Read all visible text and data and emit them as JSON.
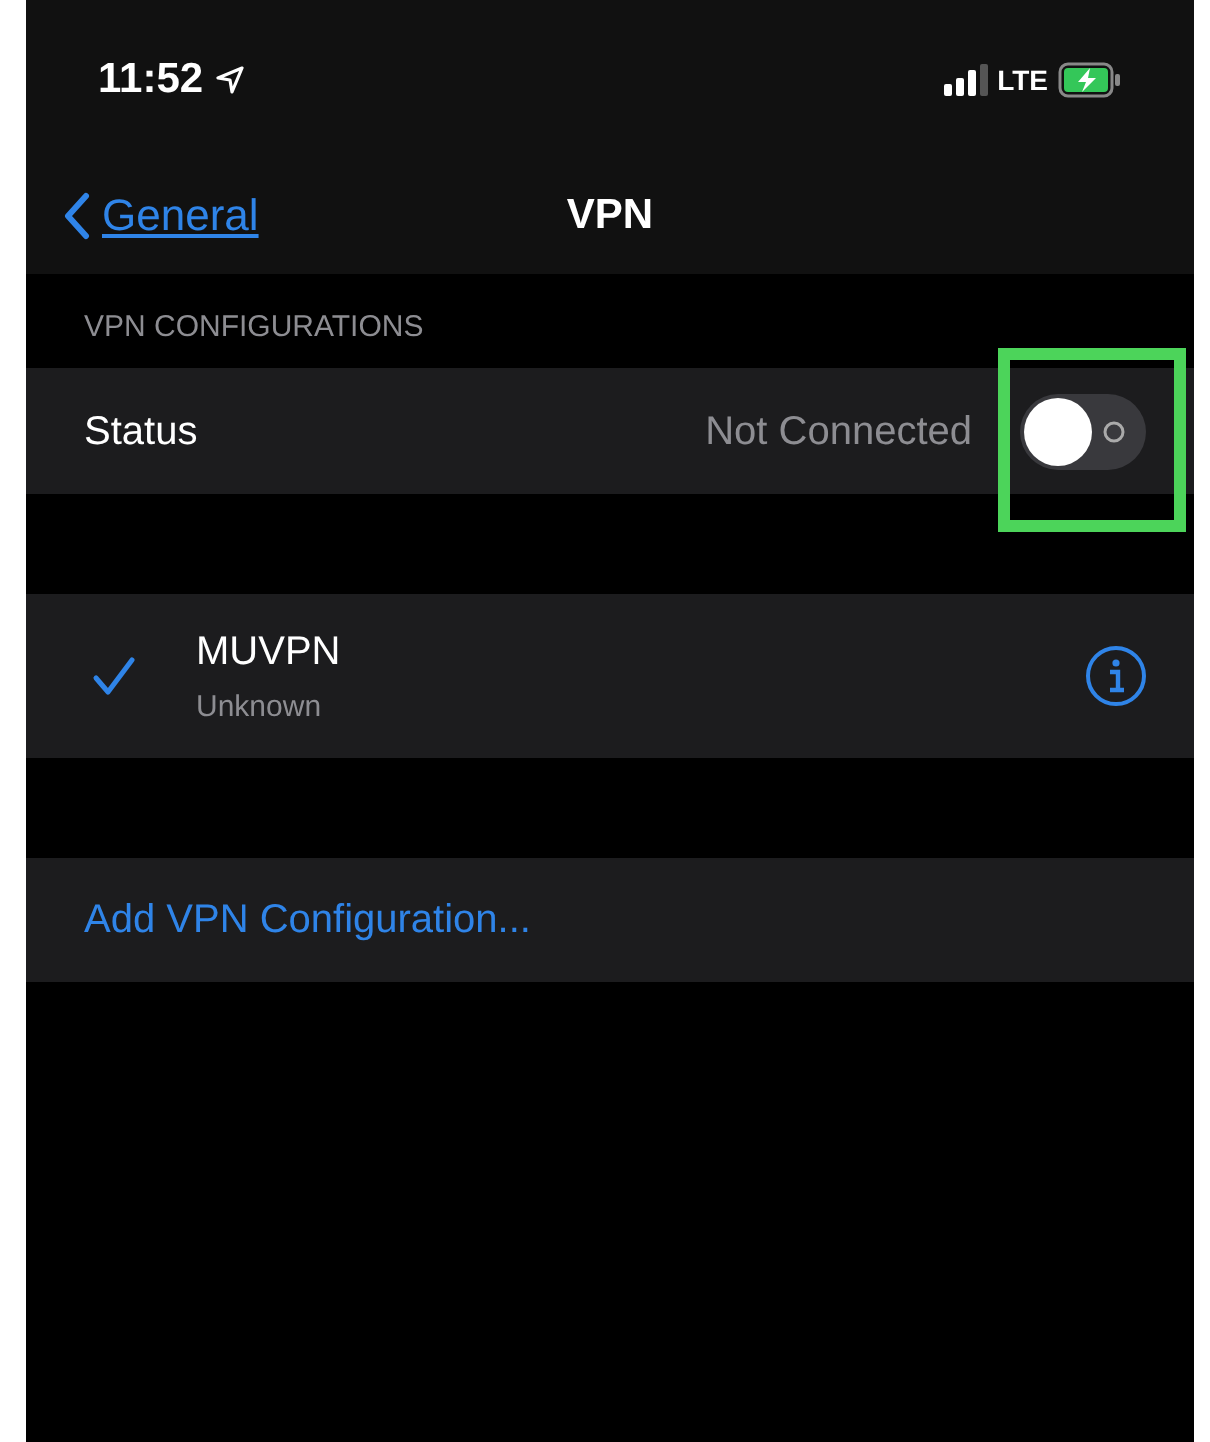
{
  "status_bar": {
    "time": "11:52",
    "network": "LTE"
  },
  "nav": {
    "back": "General",
    "title": "VPN"
  },
  "section": {
    "header": "VPN CONFIGURATIONS",
    "status_label": "Status",
    "status_value": "Not Connected",
    "toggle": {
      "on": false,
      "highlighted": true
    }
  },
  "configurations": [
    {
      "name": "MUVPN",
      "subtitle": "Unknown",
      "selected": true
    }
  ],
  "add_button": "Add VPN Configuration..."
}
